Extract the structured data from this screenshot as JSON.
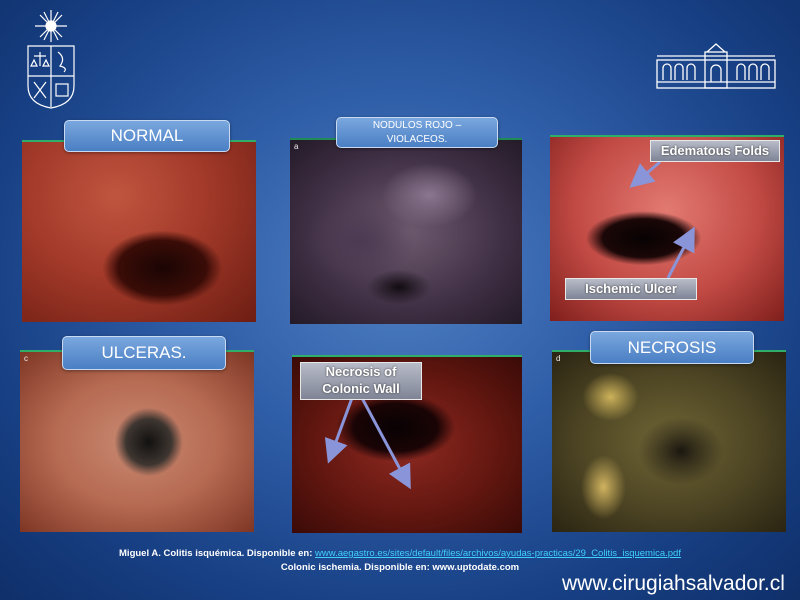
{
  "panels": [
    {
      "label": "NORMAL"
    },
    {
      "label_line1": "NODULOS ROJO –",
      "label_line2": "VIOLACEOS.",
      "corner": "a"
    },
    {
      "label": ""
    },
    {
      "label": "ULCERAS.",
      "corner": "c"
    },
    {
      "label": ""
    },
    {
      "label": "NECROSIS",
      "corner": "d"
    }
  ],
  "annotations": {
    "edematous_folds": "Edematous Folds",
    "ischemic_ulcer": "Ischemic Ulcer",
    "necrosis_line1": "Necrosis of",
    "necrosis_line2": "Colonic Wall"
  },
  "citations": {
    "line1_prefix": "Miguel A. Colitis isquémica. Disponible en:",
    "line1_link": "www.aegastro.es/sites/default/files/archivos/ayudas-practicas/29_Colitis_isquemica.pdf",
    "line2": "Colonic ischemia. Disponible en: www.uptodate.com"
  },
  "website": "www.cirugiahsalvador.cl",
  "colors": {
    "label_bg": "#5a8fd0",
    "link": "#3fd0ff",
    "arrow": "#8a94d8"
  }
}
